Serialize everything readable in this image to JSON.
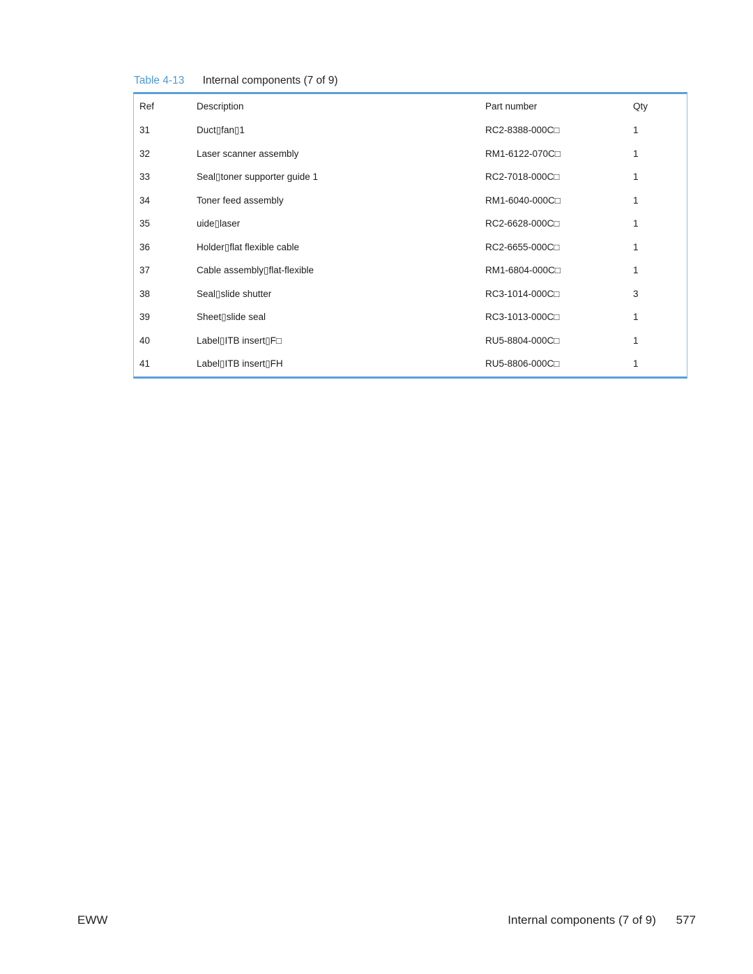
{
  "caption": {
    "number": "Table 4-13",
    "title": "Internal components (7 of 9)"
  },
  "table": {
    "headers": {
      "ref": "Ref",
      "description": "Description",
      "part_number": "Part number",
      "qty": "Qty"
    },
    "rows": [
      {
        "ref": "31",
        "description": "Duct▯fan▯1",
        "part_number": "RC2-8388-000C□",
        "qty": "1"
      },
      {
        "ref": "32",
        "description": "Laser scanner assembly",
        "part_number": "RM1-6122-070C□",
        "qty": "1"
      },
      {
        "ref": "33",
        "description": "Seal▯toner supporter guide 1",
        "part_number": "RC2-7018-000C□",
        "qty": "1"
      },
      {
        "ref": "34",
        "description": "Toner feed assembly",
        "part_number": "RM1-6040-000C□",
        "qty": "1"
      },
      {
        "ref": "35",
        "description": "uide▯laser",
        "part_number": "RC2-6628-000C□",
        "qty": "1"
      },
      {
        "ref": "36",
        "description": "Holder▯flat flexible cable",
        "part_number": "RC2-6655-000C□",
        "qty": "1"
      },
      {
        "ref": "37",
        "description": "Cable assembly▯flat-flexible",
        "part_number": "RM1-6804-000C□",
        "qty": "1"
      },
      {
        "ref": "38",
        "description": "Seal▯slide shutter",
        "part_number": "RC3-1014-000C□",
        "qty": "3"
      },
      {
        "ref": "39",
        "description": "Sheet▯slide seal",
        "part_number": "RC3-1013-000C□",
        "qty": "1"
      },
      {
        "ref": "40",
        "description": "Label▯ITB insert▯F□",
        "part_number": "RU5-8804-000C□",
        "qty": "1"
      },
      {
        "ref": "41",
        "description": "Label▯ITB insert▯FH",
        "part_number": "RU5-8806-000C□",
        "qty": "1"
      }
    ]
  },
  "footer": {
    "left": "EWW",
    "section": "Internal components (7 of 9)",
    "page": "577"
  },
  "colors": {
    "accent": "#5a9fdb",
    "caption_number": "#4a9ad8"
  }
}
